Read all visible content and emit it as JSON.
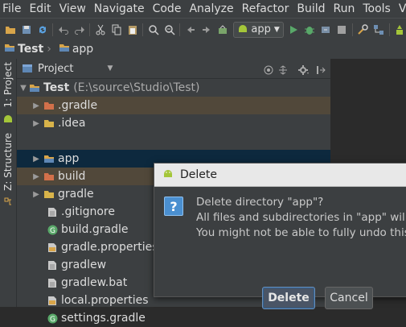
{
  "menu": [
    "File",
    "Edit",
    "View",
    "Navigate",
    "Code",
    "Analyze",
    "Refactor",
    "Build",
    "Run",
    "Tools",
    "VCS"
  ],
  "toolbar": {
    "run_config": "app"
  },
  "breadcrumb": [
    "Test",
    "app"
  ],
  "side_tabs": {
    "project": "1: Project",
    "structure": "Z: Structure"
  },
  "panel": {
    "title": "Project"
  },
  "tree": [
    {
      "label": "Test",
      "extra": "(E:\\source\\Studio\\Test)",
      "level": 0,
      "arrow": "▼",
      "icon": "folder-module-icon",
      "style": "root"
    },
    {
      "label": ".gradle",
      "level": 1,
      "arrow": "▶",
      "icon": "folder-orange-icon",
      "style": "excluded"
    },
    {
      "label": ".idea",
      "level": 1,
      "arrow": "▶",
      "icon": "folder-icon",
      "style": "normal"
    },
    {
      "label": "app",
      "level": 1,
      "arrow": "▶",
      "icon": "folder-module-icon",
      "style": "selected"
    },
    {
      "label": "build",
      "level": 1,
      "arrow": "▶",
      "icon": "folder-orange-icon",
      "style": "excluded"
    },
    {
      "label": "gradle",
      "level": 1,
      "arrow": "▶",
      "icon": "folder-icon",
      "style": "normal"
    },
    {
      "label": ".gitignore",
      "level": 1,
      "arrow": "",
      "icon": "text-file-icon",
      "style": "normal"
    },
    {
      "label": "build.gradle",
      "level": 1,
      "arrow": "",
      "icon": "gradle-icon",
      "style": "normal"
    },
    {
      "label": "gradle.properties",
      "level": 1,
      "arrow": "",
      "icon": "properties-file-icon",
      "style": "normal"
    },
    {
      "label": "gradlew",
      "level": 1,
      "arrow": "",
      "icon": "text-file-icon",
      "style": "normal"
    },
    {
      "label": "gradlew.bat",
      "level": 1,
      "arrow": "",
      "icon": "text-file-icon",
      "style": "normal"
    },
    {
      "label": "local.properties",
      "level": 1,
      "arrow": "",
      "icon": "properties-file-icon",
      "style": "normal"
    },
    {
      "label": "settings.gradle",
      "level": 1,
      "arrow": "",
      "icon": "gradle-icon",
      "style": "normal"
    }
  ],
  "dialog": {
    "title": "Delete",
    "line1": "Delete directory \"app\"?",
    "line2": "All files and subdirectories in \"app\" will be",
    "line3": "You might not be able to fully undo this",
    "delete_label": "Delete",
    "cancel_label": "Cancel"
  },
  "colors": {
    "accent": "#4a8fd0",
    "excluded_row": "#51483a",
    "selected_row": "#0d293e",
    "android_green": "#a4c639"
  }
}
